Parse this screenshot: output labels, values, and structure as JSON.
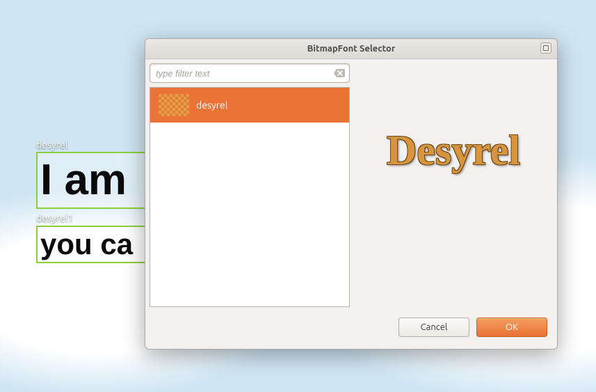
{
  "dialog": {
    "title": "BitmapFont Selector",
    "filter_placeholder": "type filter text",
    "buttons": {
      "cancel": "Cancel",
      "ok": "OK"
    }
  },
  "list": {
    "items": [
      {
        "label": "desyrel",
        "selected": true
      }
    ]
  },
  "preview": {
    "text": "Desyrel"
  },
  "editor": {
    "boxes": [
      {
        "label": "desyrel",
        "text": "I am"
      },
      {
        "label": "desyrel1",
        "text": "you ca"
      }
    ]
  }
}
